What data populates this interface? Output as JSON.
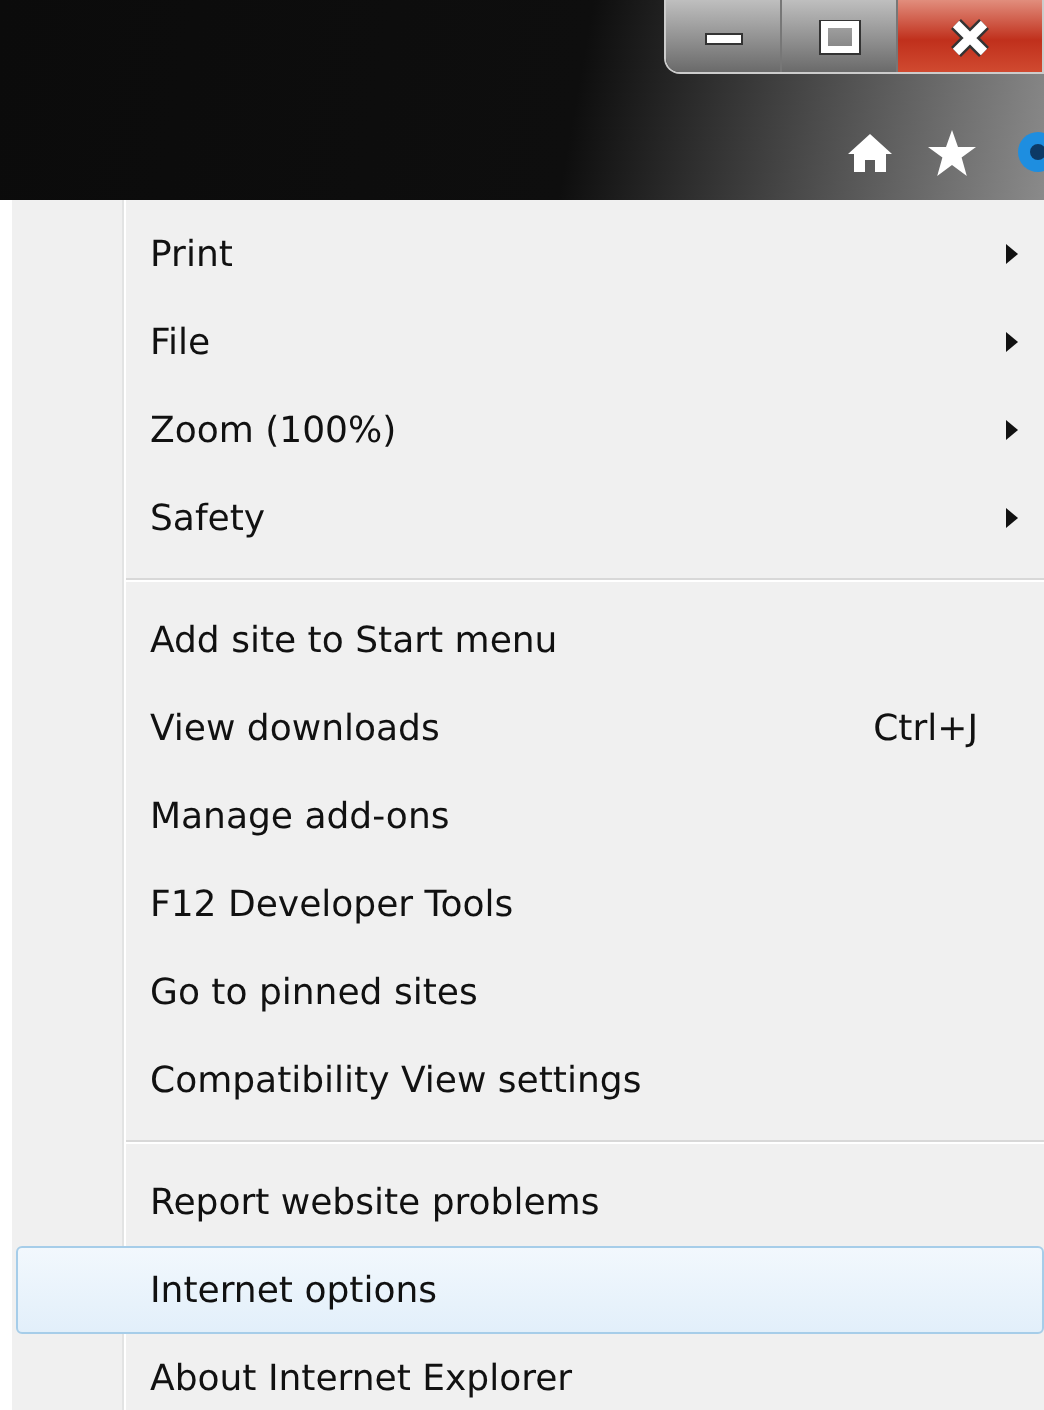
{
  "menu": {
    "sections": [
      {
        "items": [
          {
            "label": "Print",
            "submenu": true,
            "selected": false
          },
          {
            "label": "File",
            "submenu": true,
            "selected": false
          },
          {
            "label": "Zoom (100%)",
            "submenu": true,
            "selected": false
          },
          {
            "label": "Safety",
            "submenu": true,
            "selected": false
          }
        ]
      },
      {
        "items": [
          {
            "label": "Add site to Start menu",
            "submenu": false,
            "selected": false
          },
          {
            "label": "View downloads",
            "shortcut": "Ctrl+J",
            "submenu": false,
            "selected": false
          },
          {
            "label": "Manage add-ons",
            "submenu": false,
            "selected": false
          },
          {
            "label": "F12 Developer Tools",
            "submenu": false,
            "selected": false
          },
          {
            "label": "Go to pinned sites",
            "submenu": false,
            "selected": false
          },
          {
            "label": "Compatibility View settings",
            "submenu": false,
            "selected": false
          }
        ]
      },
      {
        "items": [
          {
            "label": "Report website problems",
            "submenu": false,
            "selected": false
          },
          {
            "label": "Internet options",
            "submenu": false,
            "selected": true
          },
          {
            "label": "About Internet Explorer",
            "submenu": false,
            "selected": false
          }
        ]
      }
    ]
  }
}
